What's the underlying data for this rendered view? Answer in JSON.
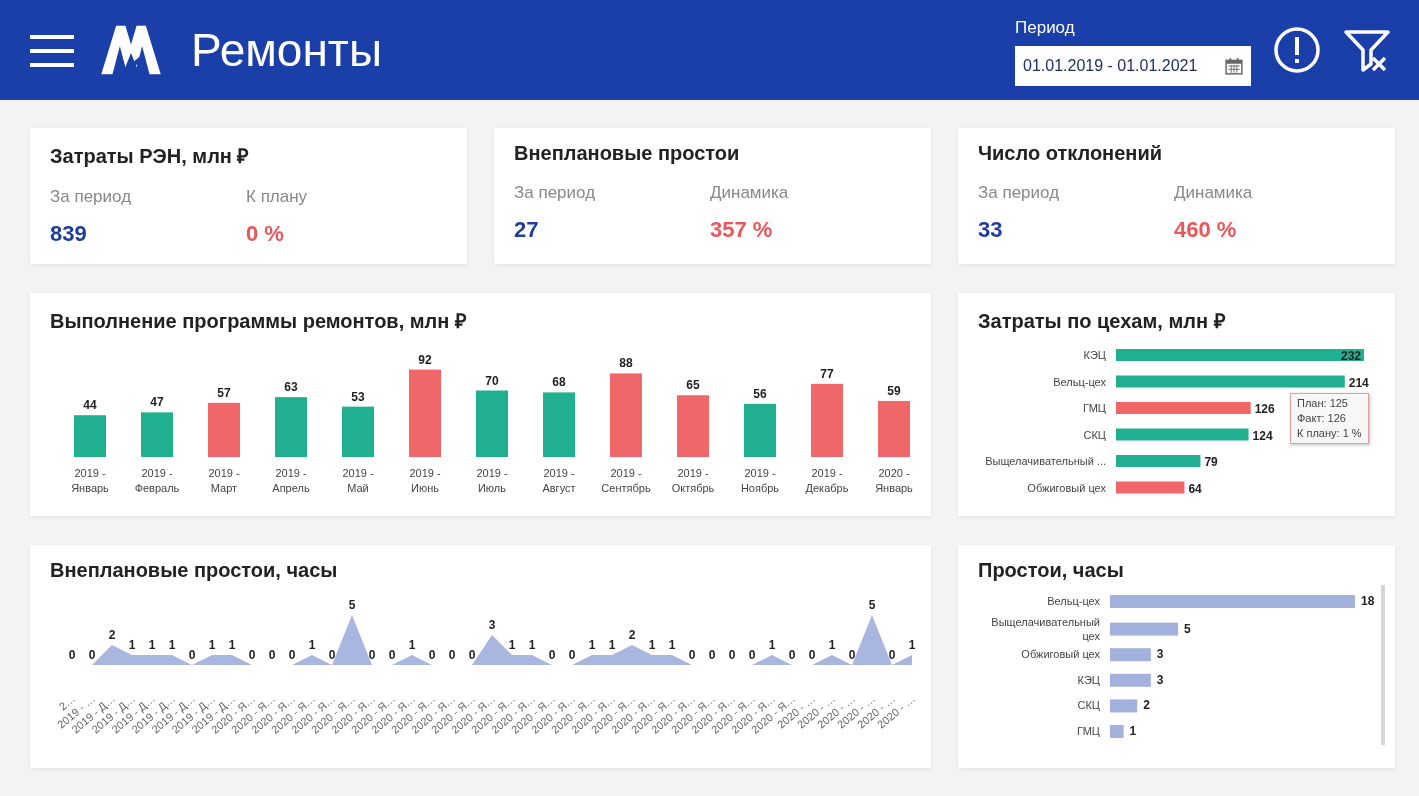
{
  "header": {
    "title": "Ремонты",
    "period": {
      "label": "Период",
      "value": "01.01.2019 - 01.01.2021"
    }
  },
  "kpis": [
    {
      "title": "Затраты РЭН, млн ₽",
      "items": [
        {
          "label": "За период",
          "value": "839",
          "color": "#1f3e9c"
        },
        {
          "label": "К плану",
          "value": "0 %",
          "color": "#e8575a"
        }
      ]
    },
    {
      "title": "Внеплановые простои",
      "items": [
        {
          "label": "За период",
          "value": "27",
          "color": "#1f3e9c"
        },
        {
          "label": "Динамика",
          "value": "357 %",
          "color": "#e8575a"
        }
      ]
    },
    {
      "title": "Число отклонений",
      "items": [
        {
          "label": "За период",
          "value": "33",
          "color": "#1f3e9c"
        },
        {
          "label": "Динамика",
          "value": "460 %",
          "color": "#e8575a"
        }
      ]
    }
  ],
  "program": {
    "title": "Выполнение программы ремонтов, млн ₽",
    "chart_data": {
      "type": "bar",
      "stacked": true,
      "data_labels": true,
      "categories": [
        "2019 - Январь",
        "2019 - Февраль",
        "2019 - Март",
        "2019 - Апрель",
        "2019 - Май",
        "2019 - Июнь",
        "2019 - Июль",
        "2019 - Август",
        "2019 - Сентябрь",
        "2019 - Октябрь",
        "2019 - Ноябрь",
        "2019 - Декабрь",
        "2020 - Январь"
      ],
      "series": [
        {
          "color": "#21b08f",
          "values": [
            44,
            47,
            null,
            63,
            53,
            null,
            70,
            68,
            null,
            null,
            56,
            null,
            null
          ]
        },
        {
          "color": "#f0676a",
          "values": [
            null,
            null,
            57,
            null,
            null,
            92,
            null,
            null,
            88,
            65,
            null,
            77,
            59
          ]
        }
      ]
    }
  },
  "shops_costs": {
    "title": "Затраты по цехам, млн ₽",
    "chart_data": {
      "type": "bar",
      "orientation": "horizontal",
      "stacked": true,
      "categories": [
        "КЭЦ",
        "Вельц-цех",
        "ГМЦ",
        "СКЦ",
        "Выщелачивательный ...",
        "Обжиговый цех"
      ],
      "series": [
        {
          "color": "#21b08f",
          "values": [
            232,
            214,
            null,
            124,
            79,
            null
          ]
        },
        {
          "color": "#f0676a",
          "values": [
            null,
            null,
            126,
            null,
            null,
            64
          ]
        }
      ],
      "data_labels": true
    },
    "tooltip": {
      "lines": [
        "План: 125",
        "Факт: 126",
        "К плану: 1 %"
      ]
    }
  },
  "downtime": {
    "title": "Внеплановые простои, часы",
    "chart_data": {
      "type": "area",
      "data_labels": true,
      "categories": [
        "2…",
        "2019 - …",
        "2019 - Д…",
        "2019 - Д…",
        "2019 - Д…",
        "2019 - Д…",
        "2019 - Д…",
        "2019 - Д…",
        "2019 - Д…",
        "2020 - Я…",
        "2020 - Я…",
        "2020 - Я…",
        "2020 - Я…",
        "2020 - Я…",
        "2020 - Я…",
        "2020 - Я…",
        "2020 - Я…",
        "2020 - Я…",
        "2020 - Я…",
        "2020 - Я…",
        "2020 - Я…",
        "2020 - Я…",
        "2020 - Я…",
        "2020 - Я…",
        "2020 - Я…",
        "2020 - Я…",
        "2020 - Я…",
        "2020 - Я…",
        "2020 - Я…",
        "2020 - Я…",
        "2020 - Я…",
        "2020 - Я…",
        "2020 - Я…",
        "2020 - Я…",
        "2020 - Я…",
        "2020 - Я…",
        "2020 - Я…",
        "2020 - …",
        "2020 - …",
        "2020 - …",
        "2020 - …",
        "2020 - …",
        "2020 - …"
      ],
      "series": [
        {
          "color": "#a9b7e0",
          "values": [
            0,
            0,
            2,
            1,
            1,
            1,
            0,
            1,
            1,
            0,
            0,
            0,
            1,
            0,
            5,
            0,
            0,
            1,
            0,
            0,
            0,
            3,
            1,
            1,
            0,
            0,
            1,
            1,
            2,
            1,
            1,
            0,
            0,
            0,
            0,
            1,
            0,
            0,
            1,
            0,
            5,
            0,
            1
          ]
        }
      ]
    }
  },
  "shops_downtime": {
    "title": "Простои, часы",
    "chart_data": {
      "type": "bar",
      "orientation": "horizontal",
      "data_labels": true,
      "categories": [
        "Вельц-цех",
        "Выщелачивательный цех",
        "Обжиговый цех",
        "КЭЦ",
        "СКЦ",
        "ГМЦ"
      ],
      "series": [
        {
          "color": "#a3b1dd",
          "values": [
            18,
            5,
            3,
            3,
            2,
            1
          ]
        }
      ]
    }
  }
}
